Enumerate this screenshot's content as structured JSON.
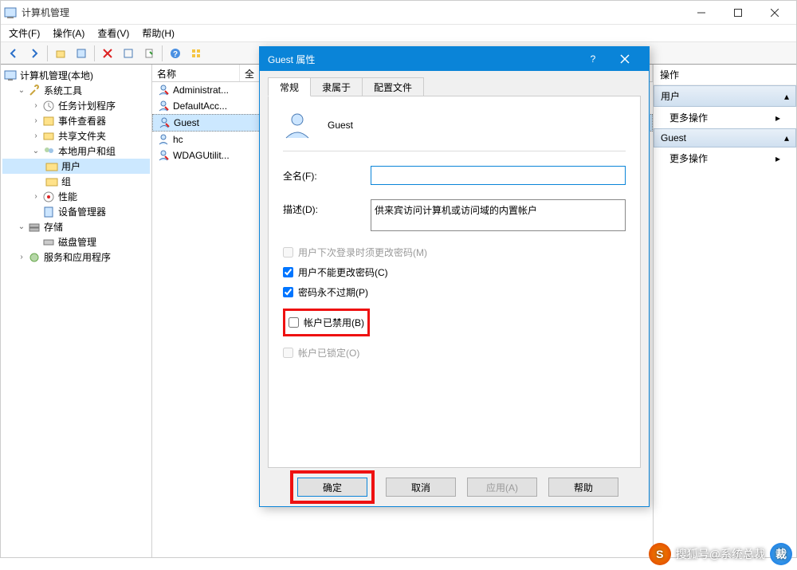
{
  "window": {
    "title": "计算机管理"
  },
  "menu": {
    "file": "文件(F)",
    "actions": "操作(A)",
    "view": "查看(V)",
    "help": "帮助(H)"
  },
  "tree": {
    "root": "计算机管理(本地)",
    "system_tools": "系统工具",
    "task_scheduler": "任务计划程序",
    "event_viewer": "事件查看器",
    "shared_folders": "共享文件夹",
    "local_users_groups": "本地用户和组",
    "users": "用户",
    "groups": "组",
    "performance": "性能",
    "device_manager": "设备管理器",
    "storage": "存储",
    "disk_management": "磁盘管理",
    "services_apps": "服务和应用程序"
  },
  "list": {
    "header_name": "名称",
    "header_full": "全",
    "rows": {
      "admin": "Administrat...",
      "default_acc": "DefaultAcc...",
      "guest": "Guest",
      "hc": "hc",
      "wdag": "WDAGUtilit..."
    }
  },
  "actions": {
    "header": "操作",
    "group_users": "用户",
    "group_guest": "Guest",
    "more": "更多操作"
  },
  "dialog": {
    "title": "Guest 属性",
    "tabs": {
      "general": "常规",
      "member_of": "隶属于",
      "profile": "配置文件"
    },
    "account_name": "Guest",
    "full_name_label": "全名(F):",
    "full_name_value": "",
    "description_label": "描述(D):",
    "description_value": "供来宾访问计算机或访问域的内置帐户",
    "cb_must_change": "用户下次登录时须更改密码(M)",
    "cb_cannot_change": "用户不能更改密码(C)",
    "cb_never_expires": "密码永不过期(P)",
    "cb_disabled": "帐户已禁用(B)",
    "cb_locked": "帐户已锁定(O)",
    "buttons": {
      "ok": "确定",
      "cancel": "取消",
      "apply": "应用(A)",
      "help": "帮助"
    }
  },
  "watermark": {
    "text": "搜狐号@系统总裁"
  }
}
